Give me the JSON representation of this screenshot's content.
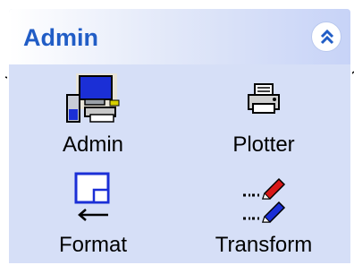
{
  "panel": {
    "title": "Admin",
    "collapse_icon": "double-chevron-up-icon",
    "items": [
      {
        "label": "Admin",
        "icon": "admin-workstation-icon"
      },
      {
        "label": "Plotter",
        "icon": "printer-icon"
      },
      {
        "label": "Format",
        "icon": "page-format-icon"
      },
      {
        "label": "Transform",
        "icon": "transform-pens-icon"
      }
    ]
  },
  "colors": {
    "panel_background": "#d6dff7",
    "title_text": "#215dc6",
    "header_gradient_end": "#c7d3f7"
  }
}
